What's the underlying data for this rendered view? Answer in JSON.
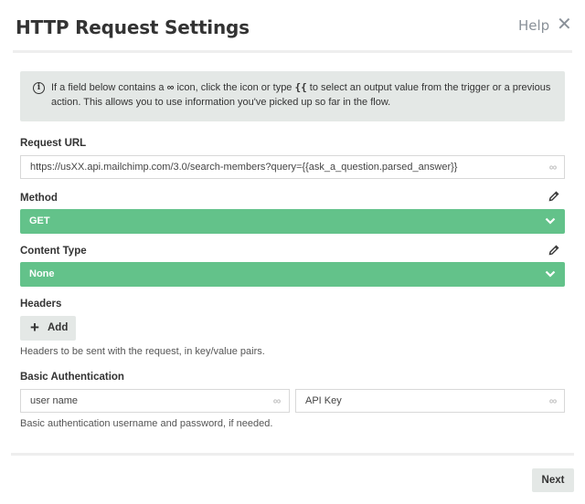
{
  "dialog": {
    "title": "HTTP Request Settings",
    "help_label": "Help",
    "close_glyph": "✕"
  },
  "info": {
    "text_1": "If a field below contains a ",
    "icon_glyph": "∞",
    "text_2": " icon, click the icon or type ",
    "braces": "{{",
    "text_3": " to select an output value from the trigger or a previous action. This allows you to use information you've picked up so far in the flow."
  },
  "request_url": {
    "label": "Request URL",
    "value": "https://usXX.api.mailchimp.com/3.0/search-members?query={{ask_a_question.parsed_answer}}",
    "icon": "dynamic-value-icon"
  },
  "method": {
    "label": "Method",
    "value": "GET"
  },
  "content_type": {
    "label": "Content Type",
    "value": "None"
  },
  "headers": {
    "label": "Headers",
    "add_label": "Add",
    "help": "Headers to be sent with the request, in key/value pairs."
  },
  "basic_auth": {
    "label": "Basic Authentication",
    "username_value": "user name",
    "password_value": "API Key",
    "help": "Basic authentication username and password, if needed."
  },
  "footer": {
    "next_label": "Next"
  },
  "colors": {
    "accent_green": "#63c28a",
    "info_bg": "#e4e8e6",
    "muted": "#8a9199"
  }
}
